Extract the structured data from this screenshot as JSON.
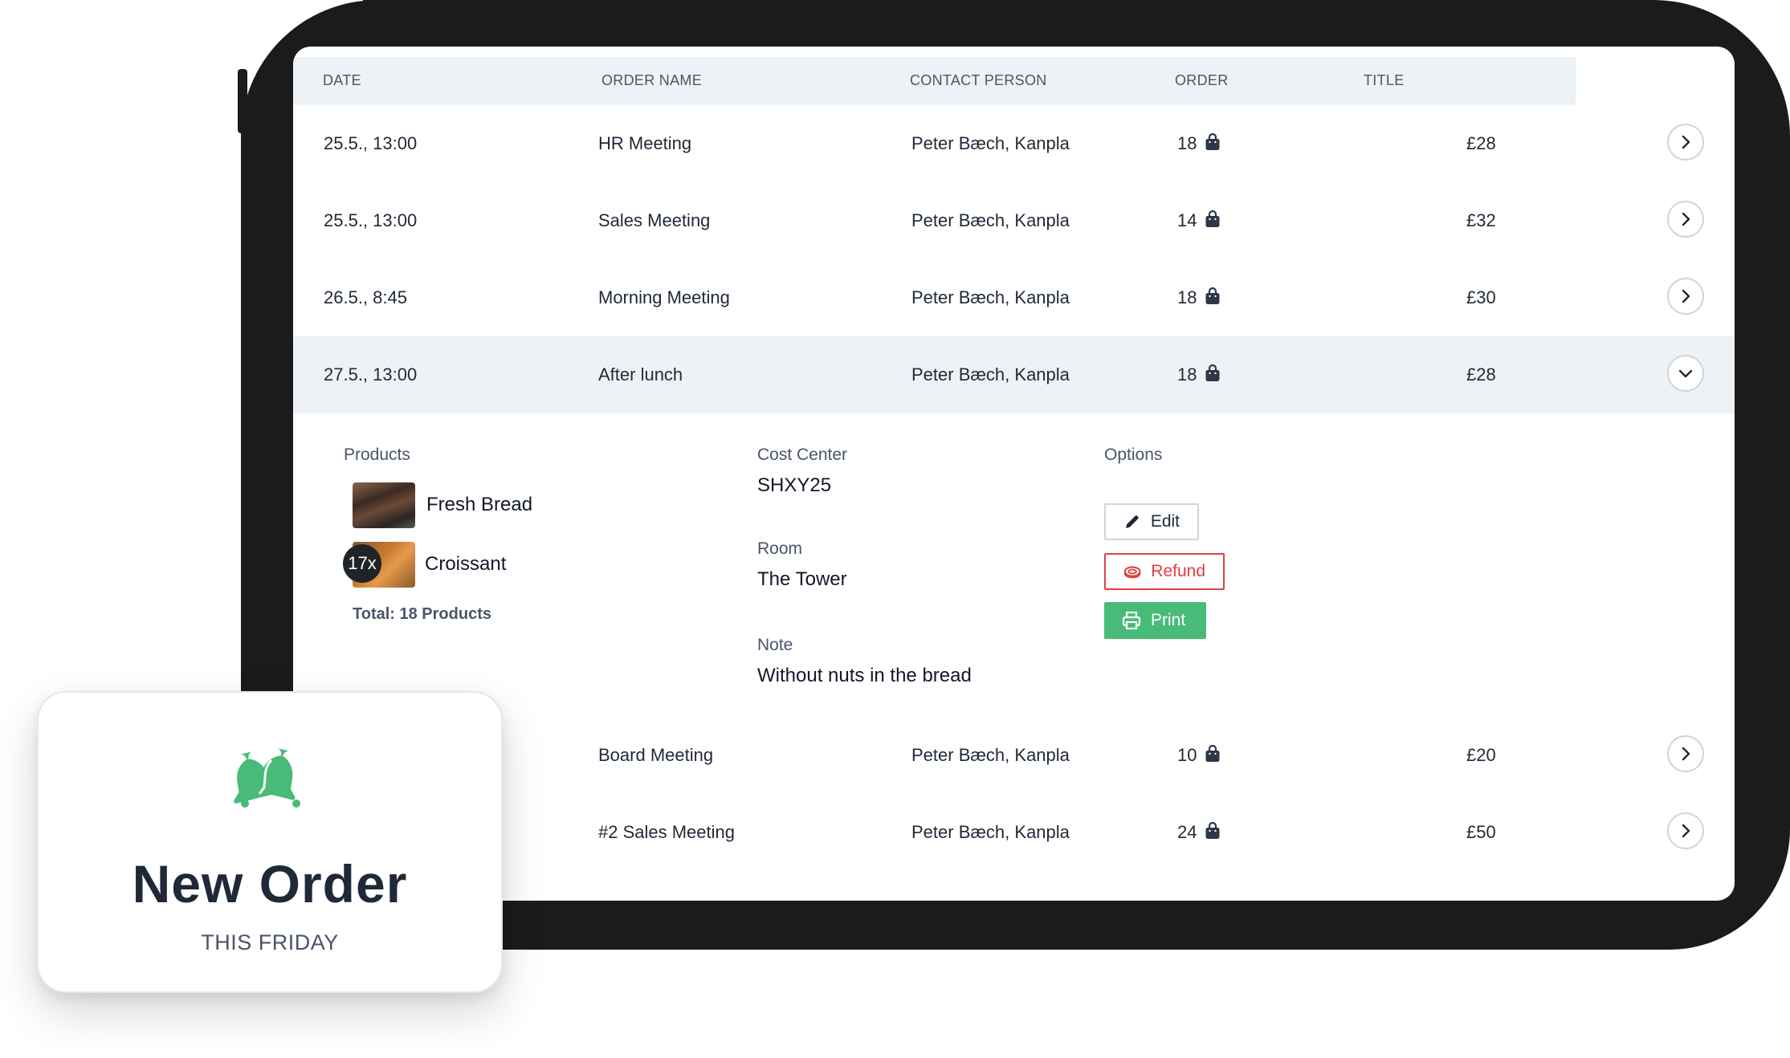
{
  "table": {
    "headers": [
      "DATE",
      "ORDER NAME",
      "CONTACT PERSON",
      "ORDER",
      "TITLE"
    ],
    "rows": [
      {
        "date": "25.5., 13:00",
        "name": "HR Meeting",
        "contact": "Peter Bæch, Kanpla",
        "count": "18",
        "price": "£28"
      },
      {
        "date": "25.5., 13:00",
        "name": "Sales Meeting",
        "contact": "Peter Bæch, Kanpla",
        "count": "14",
        "price": "£32"
      },
      {
        "date": "26.5., 8:45",
        "name": "Morning Meeting",
        "contact": "Peter Bæch, Kanpla",
        "count": "18",
        "price": "£30"
      },
      {
        "date": "27.5., 13:00",
        "name": "After lunch",
        "contact": "Peter Bæch, Kanpla",
        "count": "18",
        "price": "£28"
      },
      {
        "date": "",
        "name": "Board Meeting",
        "contact": "Peter Bæch, Kanpla",
        "count": "10",
        "price": "£20"
      },
      {
        "date": "",
        "name": "#2 Sales Meeting",
        "contact": "Peter Bæch, Kanpla",
        "count": "24",
        "price": "£50"
      }
    ]
  },
  "details": {
    "products_label": "Products",
    "products": [
      {
        "name": "Fresh Bread",
        "qty": ""
      },
      {
        "name": "Croissant",
        "qty": "17x"
      }
    ],
    "total": "Total: 18 Products",
    "cost_center_label": "Cost Center",
    "cost_center": "SHXY25",
    "room_label": "Room",
    "room": "The Tower",
    "note_label": "Note",
    "note": "Without nuts in the bread",
    "options_label": "Options",
    "edit_label": "Edit",
    "refund_label": "Refund",
    "print_label": "Print"
  },
  "notification": {
    "title": "New Order",
    "subtitle": "THIS FRIDAY"
  },
  "colors": {
    "accent_green": "#48bb78",
    "danger_red": "#e53e3e",
    "header_bg": "#edf2f7",
    "device_frame": "#1b1b1b"
  },
  "icons": [
    "shopping-bag-icon",
    "chevron-right-icon",
    "chevron-down-icon",
    "pencil-icon",
    "refund-icon",
    "printer-icon",
    "bell-icon"
  ]
}
